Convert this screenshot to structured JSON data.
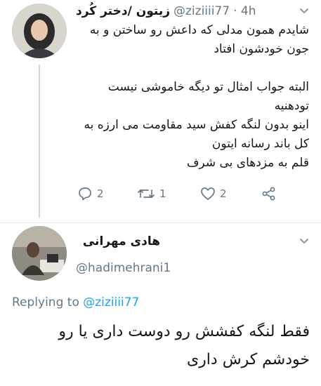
{
  "tweet1": {
    "display_name": "زیتون /دختر کُرد",
    "handle": "@ziziiii77",
    "time": "· 4h",
    "lines": [
      "شایدم همون مدلی که داعش رو ساختن و به",
      "جون خودشون افتاد",
      "",
      "البته جواب امثال تو دیگه خاموشی نیست",
      "تودهنیه",
      "اینو بدون لنگه کفش سید مقاومت می ارزه به",
      "کل باند رسانه ایتون",
      "قلم به مزدهای بی شرف"
    ],
    "replies": "2",
    "retweets": "1",
    "likes": "2"
  },
  "tweet2": {
    "display_name": "هادی مهرانی",
    "handle": "@hadimehrani1",
    "replying_prefix": "Replying to",
    "replying_to": "@ziziiii77",
    "lines": [
      "فقط لنگه کفشش رو دوست داری یا رو",
      "خودشم کرش داری"
    ]
  }
}
